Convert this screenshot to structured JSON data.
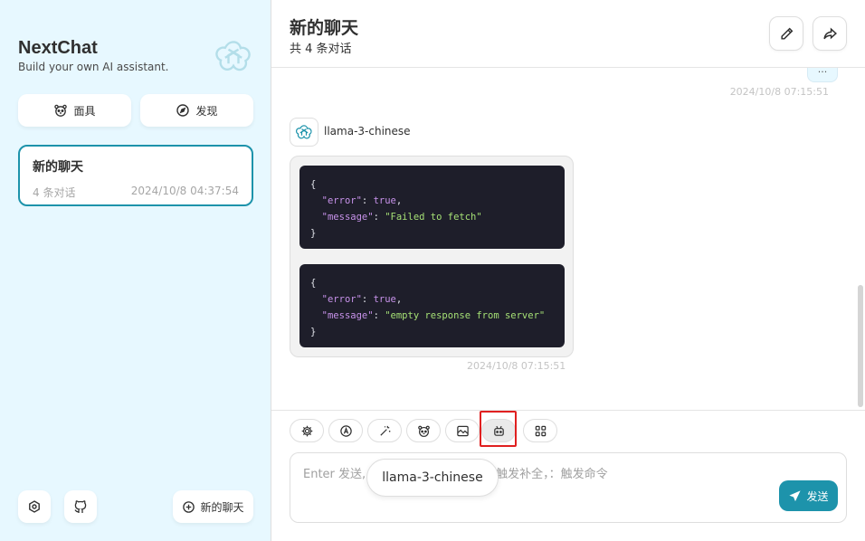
{
  "sidebar": {
    "brand_title": "NextChat",
    "brand_subtitle": "Build your own AI assistant.",
    "mask_label": "面具",
    "discover_label": "发现",
    "chats": [
      {
        "title": "新的聊天",
        "count": "4 条对话",
        "time": "2024/10/8 04:37:54"
      }
    ],
    "new_chat_label": "新的聊天"
  },
  "header": {
    "title": "新的聊天",
    "subtitle": "共 4 条对话"
  },
  "messages": {
    "prev_bubble": "...",
    "prev_time": "2024/10/8 07:15:51",
    "bot_name": "llama-3-chinese",
    "code_blocks": [
      {
        "key1": "\"error\"",
        "val1": "true",
        "key2": "\"message\"",
        "val2": "\"Failed to fetch\""
      },
      {
        "key1": "\"error\"",
        "val1": "true",
        "key2": "\"message\"",
        "val2": "\"empty response from server\""
      }
    ],
    "bot_time": "2024/10/8 07:15:51"
  },
  "input": {
    "placeholder_start": "Enter 发送,",
    "placeholder_end": "触发补全，：触发命令",
    "model_tooltip": "llama-3-chinese",
    "send_label": "发送"
  },
  "colors": {
    "accent": "#1d93ab",
    "sidebar_bg": "#e7f8ff",
    "highlight": "#e02020"
  }
}
